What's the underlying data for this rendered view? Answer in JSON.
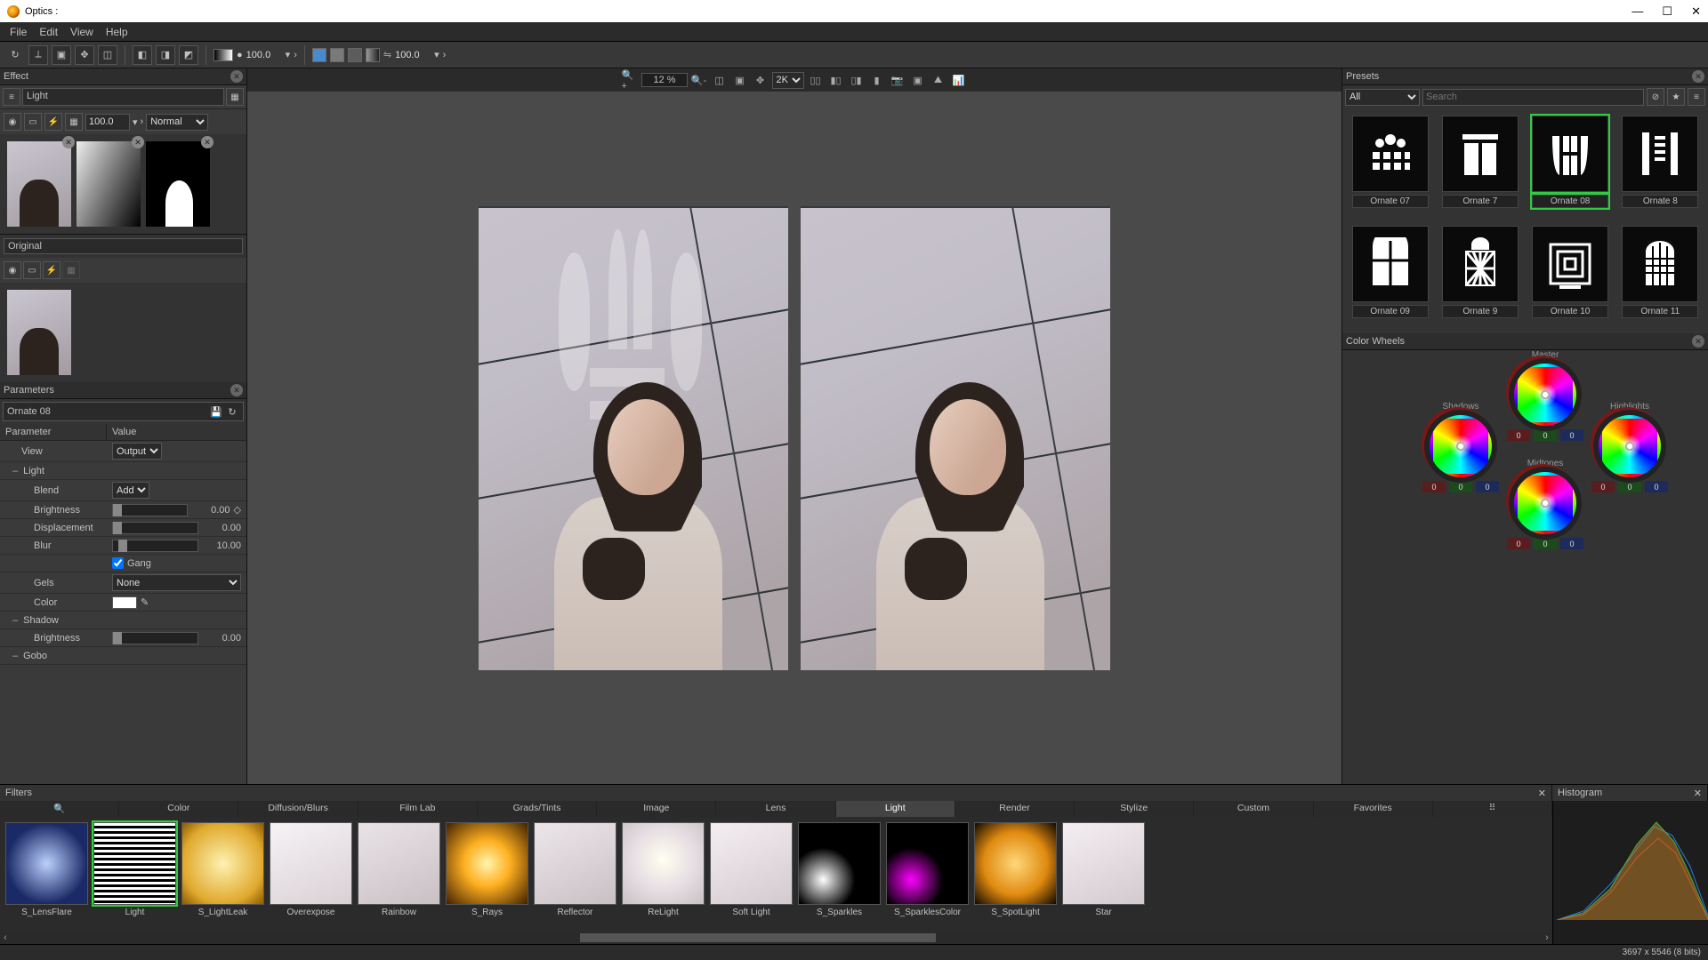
{
  "window": {
    "title": "Optics :"
  },
  "menu": [
    "File",
    "Edit",
    "View",
    "Help"
  ],
  "toolbar": {
    "opacity1": "100.0",
    "opacity2": "100.0"
  },
  "effect": {
    "title": "Effect",
    "name": "Light",
    "opacity": "100.0",
    "blend": "Normal",
    "original_label": "Original"
  },
  "params": {
    "title": "Parameters",
    "preset_name": "Ornate 08",
    "header": {
      "k": "Parameter",
      "v": "Value"
    },
    "view": {
      "label": "View",
      "value": "Output"
    },
    "light_group": "Light",
    "blend": {
      "label": "Blend",
      "value": "Add"
    },
    "brightness": {
      "label": "Brightness",
      "value": "0.00"
    },
    "displacement": {
      "label": "Displacement",
      "value": "0.00"
    },
    "blur": {
      "label": "Blur",
      "value": "10.00"
    },
    "gang": {
      "label": "Gang",
      "checked": true
    },
    "gels": {
      "label": "Gels",
      "value": "None"
    },
    "color": {
      "label": "Color",
      "value": "#ffffff"
    },
    "shadow_group": "Shadow",
    "shadow_brightness": {
      "label": "Brightness",
      "value": "0.00"
    },
    "gobo_group": "Gobo"
  },
  "viewer": {
    "zoom": "12 %",
    "res": "2K"
  },
  "presets": {
    "title": "Presets",
    "filter": "All",
    "search_placeholder": "Search",
    "items": [
      {
        "name": "Ornate 07"
      },
      {
        "name": "Ornate 7"
      },
      {
        "name": "Ornate 08",
        "selected": true
      },
      {
        "name": "Ornate 8"
      },
      {
        "name": "Ornate 09"
      },
      {
        "name": "Ornate 9"
      },
      {
        "name": "Ornate 10"
      },
      {
        "name": "Ornate 11"
      }
    ]
  },
  "color_wheels": {
    "title": "Color Wheels",
    "master": "Master",
    "shadows": "Shadows",
    "midtones": "Midtones",
    "highlights": "Highlights",
    "rgb_zero": "0"
  },
  "filters": {
    "title": "Filters",
    "categories": [
      "Color",
      "Diffusion/Blurs",
      "Film Lab",
      "Grads/Tints",
      "Image",
      "Lens",
      "Light",
      "Render",
      "Stylize",
      "Custom",
      "Favorites"
    ],
    "active": "Light",
    "items": [
      {
        "name": "S_LensFlare"
      },
      {
        "name": "Light",
        "selected": true
      },
      {
        "name": "S_LightLeak"
      },
      {
        "name": "Overexpose"
      },
      {
        "name": "Rainbow"
      },
      {
        "name": "S_Rays"
      },
      {
        "name": "Reflector"
      },
      {
        "name": "ReLight"
      },
      {
        "name": "Soft Light"
      },
      {
        "name": "S_Sparkles"
      },
      {
        "name": "S_SparklesColor"
      },
      {
        "name": "S_SpotLight"
      },
      {
        "name": "Star"
      }
    ]
  },
  "histogram": {
    "title": "Histogram"
  },
  "status": {
    "dims": "3697 x 5546 (8 bits)"
  }
}
